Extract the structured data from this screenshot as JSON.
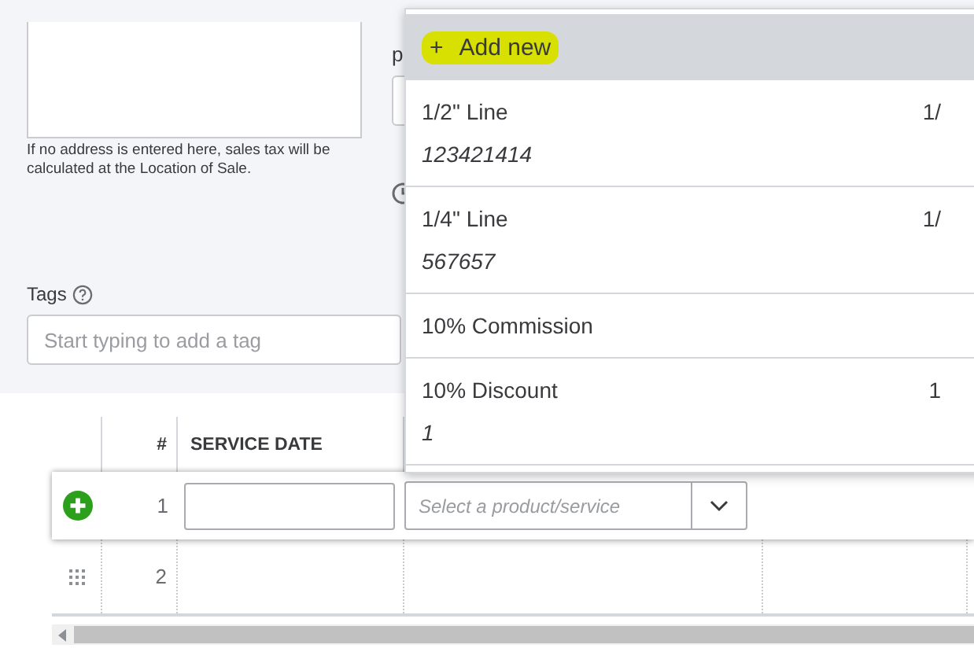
{
  "address": {
    "note": "If no address is entered here, sales tax will be calculated at the Location of Sale."
  },
  "partial_label": "p",
  "tags": {
    "label": "Tags",
    "placeholder": "Start typing to add a tag"
  },
  "table": {
    "columns": [
      "#",
      "SERVICE DATE"
    ],
    "rows": [
      {
        "number": "1",
        "selected": true,
        "product_placeholder": "Select a product/service"
      },
      {
        "number": "2",
        "selected": false
      }
    ]
  },
  "dropdown": {
    "plus": "+",
    "add_new": "Add new",
    "items": [
      {
        "name": "1/2\" Line",
        "column_2": "1/",
        "description": "123421414"
      },
      {
        "name": "1/4\" Line",
        "column_2": "1/",
        "description": "567657"
      },
      {
        "name": "10% Commission"
      },
      {
        "name": "10% Discount",
        "column_2": "1",
        "description": "1"
      }
    ]
  }
}
